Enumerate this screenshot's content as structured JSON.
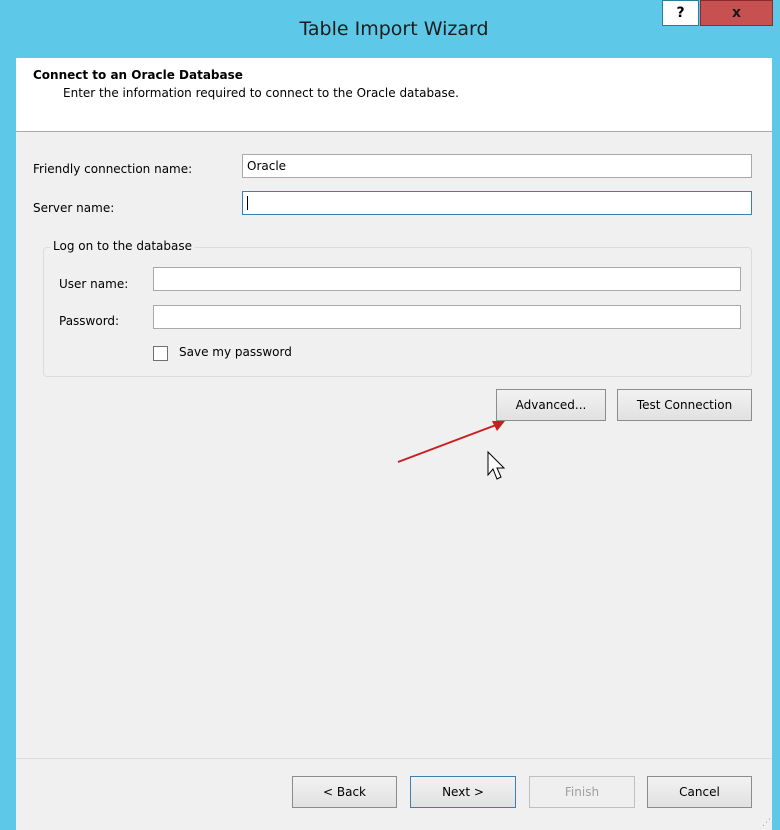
{
  "window": {
    "title": "Table Import Wizard",
    "help_label": "?",
    "close_label": "x"
  },
  "header": {
    "title": "Connect to an Oracle Database",
    "subtitle": "Enter the information required to connect to the Oracle database."
  },
  "form": {
    "friendly_name_label": "Friendly connection name:",
    "friendly_name_value": "Oracle",
    "server_name_label": "Server name:",
    "server_name_value": ""
  },
  "logon": {
    "legend": "Log on to the database",
    "username_label": "User name:",
    "username_value": "",
    "password_label": "Password:",
    "password_value": "",
    "save_password_label": "Save my password",
    "save_password_checked": false
  },
  "actions": {
    "advanced_label": "Advanced...",
    "test_connection_label": "Test Connection"
  },
  "footer": {
    "back_label": "< Back",
    "next_label": "Next >",
    "finish_label": "Finish",
    "cancel_label": "Cancel"
  },
  "annotation": {
    "arrow_color": "#c81e1e"
  }
}
